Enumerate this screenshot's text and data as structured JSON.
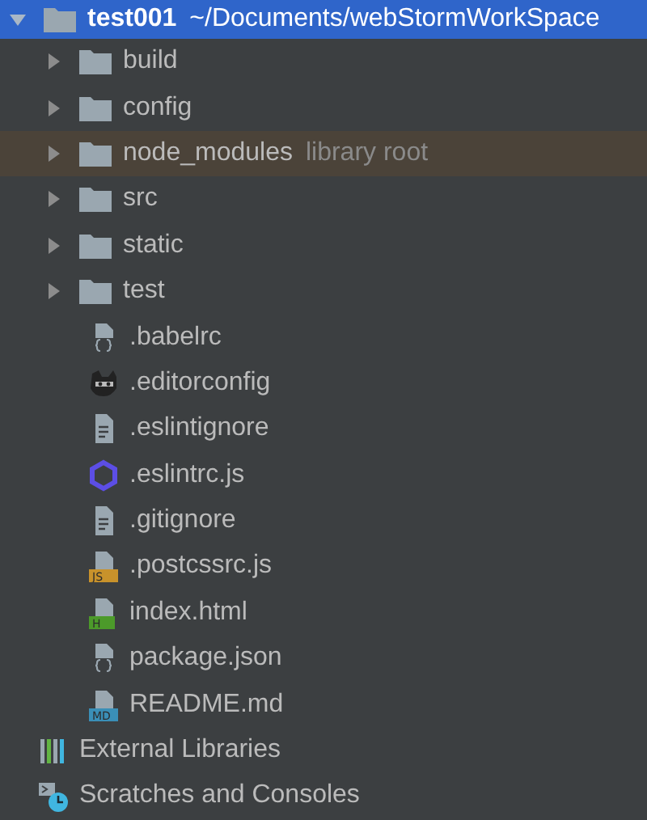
{
  "project": {
    "name": "test001",
    "path": "~/Documents/webStormWorkSpace",
    "expanded": true,
    "selected": true,
    "children": [
      {
        "kind": "folder",
        "name": "build",
        "expanded": false,
        "excluded": false
      },
      {
        "kind": "folder",
        "name": "config",
        "expanded": false,
        "excluded": false
      },
      {
        "kind": "folder",
        "name": "node_modules",
        "expanded": false,
        "excluded": true,
        "note": "library root"
      },
      {
        "kind": "folder",
        "name": "src",
        "expanded": false,
        "excluded": false
      },
      {
        "kind": "folder",
        "name": "static",
        "expanded": false,
        "excluded": false
      },
      {
        "kind": "folder",
        "name": "test",
        "expanded": false,
        "excluded": false
      },
      {
        "kind": "json",
        "name": ".babelrc"
      },
      {
        "kind": "editorconfig",
        "name": ".editorconfig"
      },
      {
        "kind": "text",
        "name": ".eslintignore"
      },
      {
        "kind": "eslint",
        "name": ".eslintrc.js"
      },
      {
        "kind": "text",
        "name": ".gitignore"
      },
      {
        "kind": "js",
        "name": ".postcssrc.js",
        "badge": "JS"
      },
      {
        "kind": "html",
        "name": "index.html",
        "badge": "H"
      },
      {
        "kind": "json",
        "name": "package.json"
      },
      {
        "kind": "md",
        "name": "README.md",
        "badge": "MD"
      }
    ]
  },
  "extras": [
    {
      "kind": "libraries",
      "name": "External Libraries"
    },
    {
      "kind": "scratches",
      "name": "Scratches and Consoles"
    }
  ]
}
